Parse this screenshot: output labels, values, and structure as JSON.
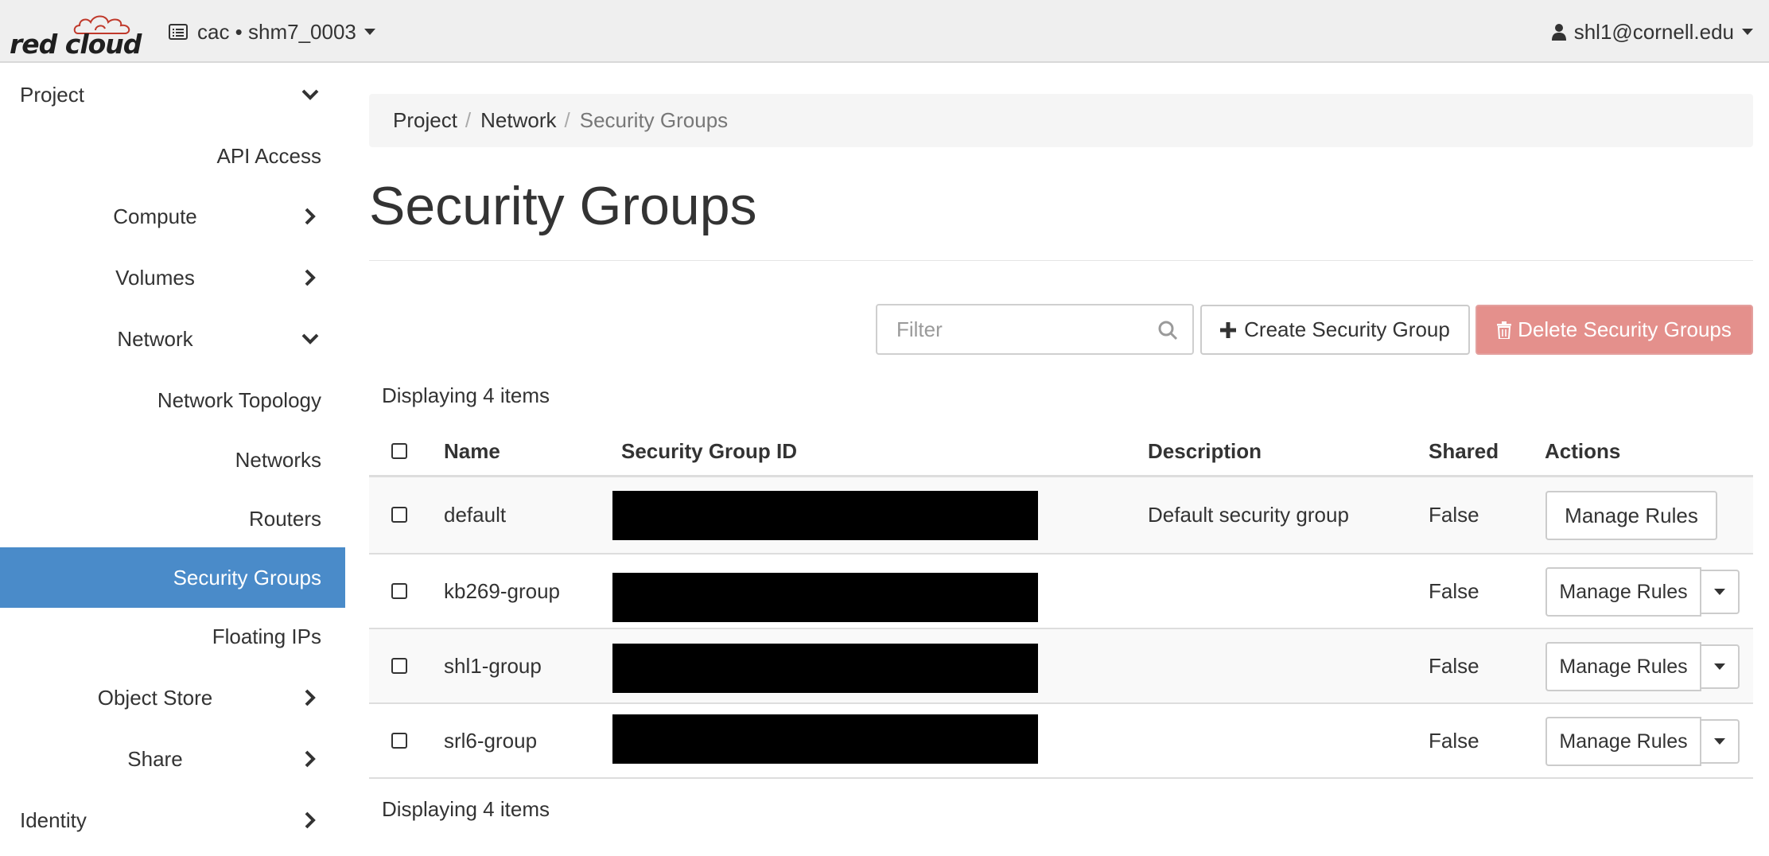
{
  "brand": {
    "logo_text": "red cloud"
  },
  "header": {
    "project_selector": "cac • shm7_0003",
    "user": "shl1@cornell.edu"
  },
  "sidebar": {
    "items": [
      {
        "label": "Project",
        "state": "expanded"
      },
      {
        "label": "API Access"
      },
      {
        "label": "Compute",
        "state": "collapsed"
      },
      {
        "label": "Volumes",
        "state": "collapsed"
      },
      {
        "label": "Network",
        "state": "expanded"
      },
      {
        "label": "Network Topology"
      },
      {
        "label": "Networks"
      },
      {
        "label": "Routers"
      },
      {
        "label": "Security Groups",
        "active": true
      },
      {
        "label": "Floating IPs"
      },
      {
        "label": "Object Store",
        "state": "collapsed"
      },
      {
        "label": "Share",
        "state": "collapsed"
      },
      {
        "label": "Identity",
        "state": "collapsed"
      }
    ]
  },
  "breadcrumb": [
    "Project",
    "Network",
    "Security Groups"
  ],
  "page": {
    "title": "Security Groups"
  },
  "toolbar": {
    "filter_placeholder": "Filter",
    "create_label": "Create Security Group",
    "delete_label": "Delete Security Groups"
  },
  "table": {
    "count_text": "Displaying 4 items",
    "columns": [
      "Name",
      "Security Group ID",
      "Description",
      "Shared",
      "Actions"
    ],
    "rows": [
      {
        "name": "default",
        "description": "Default security group",
        "shared": "False",
        "action": "Manage Rules"
      },
      {
        "name": "kb269-group",
        "description": "",
        "shared": "False",
        "action": "Manage Rules"
      },
      {
        "name": "shl1-group",
        "description": "",
        "shared": "False",
        "action": "Manage Rules"
      },
      {
        "name": "srl6-group",
        "description": "",
        "shared": "False",
        "action": "Manage Rules"
      }
    ]
  },
  "colors": {
    "active_nav": "#4a8bc9",
    "danger_button": "#e4908c",
    "navbar_bg": "#efefef",
    "redaction": "#000000"
  },
  "icons": [
    "cloud-logo-icon",
    "list-icon",
    "user-icon",
    "chevron-down-icon",
    "chevron-right-icon",
    "search-icon",
    "plus-icon",
    "trash-icon",
    "caret-down-icon"
  ]
}
